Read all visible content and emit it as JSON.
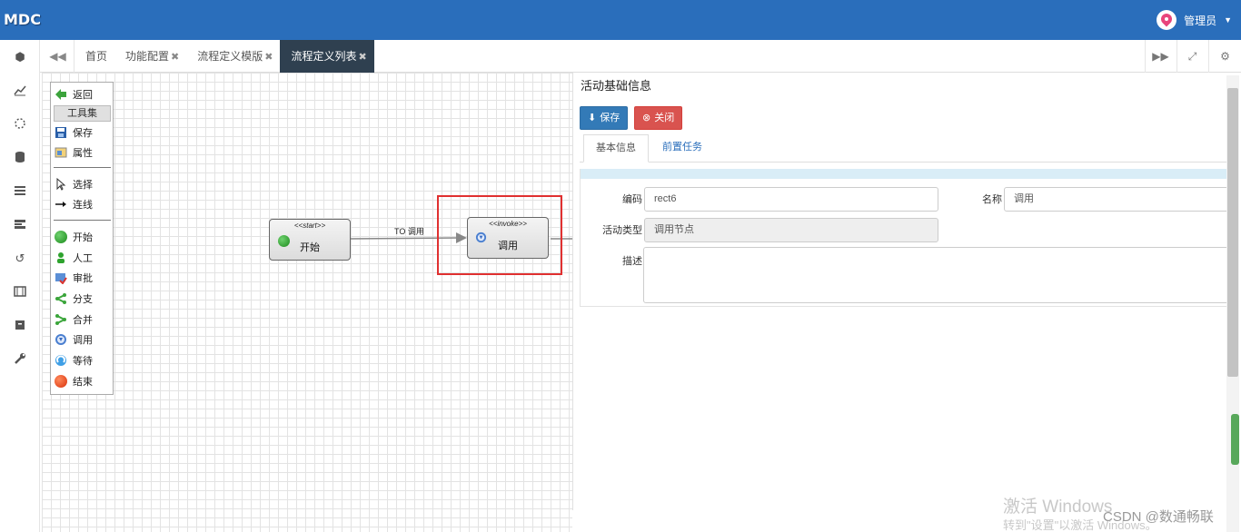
{
  "app": {
    "brand": "MDC",
    "user": "管理员"
  },
  "tabs": [
    {
      "label": "首页",
      "closable": false,
      "active": false
    },
    {
      "label": "功能配置",
      "closable": true,
      "active": false
    },
    {
      "label": "流程定义模版",
      "closable": true,
      "active": false
    },
    {
      "label": "流程定义列表",
      "closable": true,
      "active": true
    }
  ],
  "tab_close_glyph": "✖",
  "sidebar_icons": [
    "cube-icon",
    "line-chart-icon",
    "spinner-icon",
    "database-icon",
    "list-icon",
    "tasks-icon",
    "history-icon",
    "film-icon",
    "archive-icon",
    "wrench-icon"
  ],
  "toolbox": {
    "back": "返回",
    "header": "工具集",
    "save": "保存",
    "properties": "属性",
    "select": "选择",
    "connect": "连线",
    "start": "开始",
    "manual": "人工",
    "approve": "审批",
    "fork": "分支",
    "join": "合并",
    "invoke": "调用",
    "wait": "等待",
    "end": "结束"
  },
  "diagram": {
    "start_node": {
      "stereotype": "<<start>>",
      "label": "开始"
    },
    "invoke_node": {
      "stereotype": "<<invoke>>",
      "label": "调用"
    },
    "edge_label": "TO 调用"
  },
  "panel": {
    "title": "活动基础信息",
    "save_button": "保存",
    "close_button": "关闭",
    "form_tabs": [
      "基本信息",
      "前置任务"
    ],
    "fields": {
      "code_label": "编码",
      "code_value": "rect6",
      "name_label": "名称",
      "name_value": "调用",
      "type_label": "活动类型",
      "type_value": "调用节点",
      "desc_label": "描述",
      "desc_value": ""
    }
  },
  "watermark": {
    "activate": "激活 Windows",
    "hint": "转到\"设置\"以激活 Windows。",
    "csdn": "CSDN @数通畅联"
  },
  "colors": {
    "header": "#2a6ebb",
    "active_tab": "#2f4050",
    "save": "#337ab7",
    "close": "#d9534f",
    "highlight": "#e03030"
  }
}
